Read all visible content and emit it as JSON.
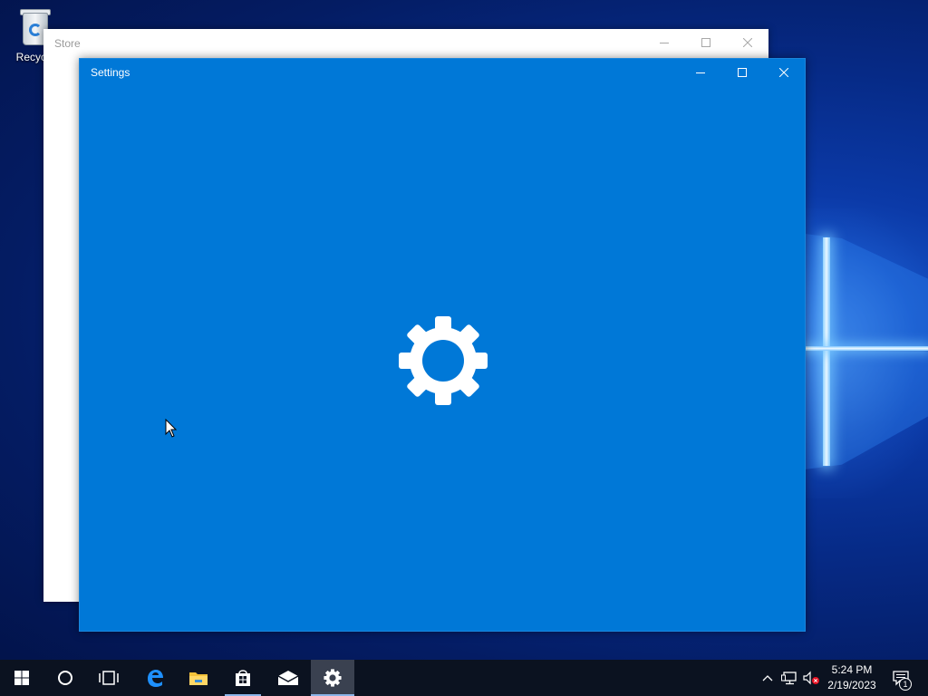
{
  "desktop": {
    "icons": [
      {
        "label": "Recycle",
        "icon": "recycle-bin-icon"
      }
    ]
  },
  "windows": {
    "store": {
      "title": "Store",
      "controls": [
        "minimize-icon",
        "maximize-icon",
        "close-icon"
      ]
    },
    "settings": {
      "title": "Settings",
      "controls": [
        "minimize-icon",
        "maximize-icon",
        "close-icon"
      ],
      "splash_icon": "gear-icon",
      "accent_color": "#0078d7"
    }
  },
  "taskbar": {
    "buttons": [
      {
        "name": "start",
        "icon": "windows-logo-icon"
      },
      {
        "name": "search",
        "icon": "cortana-circle-icon"
      },
      {
        "name": "task-view",
        "icon": "task-view-icon"
      },
      {
        "name": "edge",
        "icon": "edge-icon"
      },
      {
        "name": "file-explorer",
        "icon": "folder-icon"
      },
      {
        "name": "store",
        "icon": "store-bag-icon",
        "state": "open"
      },
      {
        "name": "mail",
        "icon": "mail-icon"
      },
      {
        "name": "settings",
        "icon": "gear-icon",
        "state": "active"
      }
    ],
    "tray": {
      "icons": [
        "chevron-up-icon",
        "network-icon",
        "volume-muted-icon"
      ],
      "time": "5:24 PM",
      "date": "2/19/2023",
      "notifications_count": "1"
    }
  }
}
